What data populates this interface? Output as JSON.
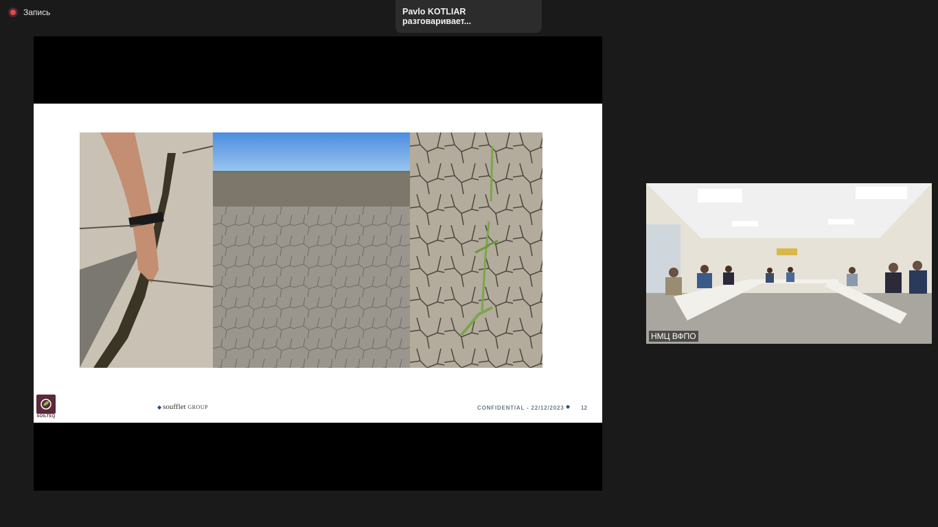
{
  "recording": {
    "label": "Запись",
    "icon": "record-icon",
    "color": "#e04a4a"
  },
  "speaker": {
    "text": "Pavlo KOTLIAR разговаривает..."
  },
  "slide": {
    "brand_left": "SOILTEQ",
    "brand_center": "soufflet",
    "brand_center_group": "GROUP",
    "footer": "CONFIDENTIAL - 22/12/2023",
    "page_number": "12",
    "photos": [
      "cracked-soil-hand-photo",
      "dry-field-panorama-photo",
      "seedlings-cracked-soil-photo"
    ]
  },
  "participant": {
    "name": "НМЦ ВФПО"
  }
}
